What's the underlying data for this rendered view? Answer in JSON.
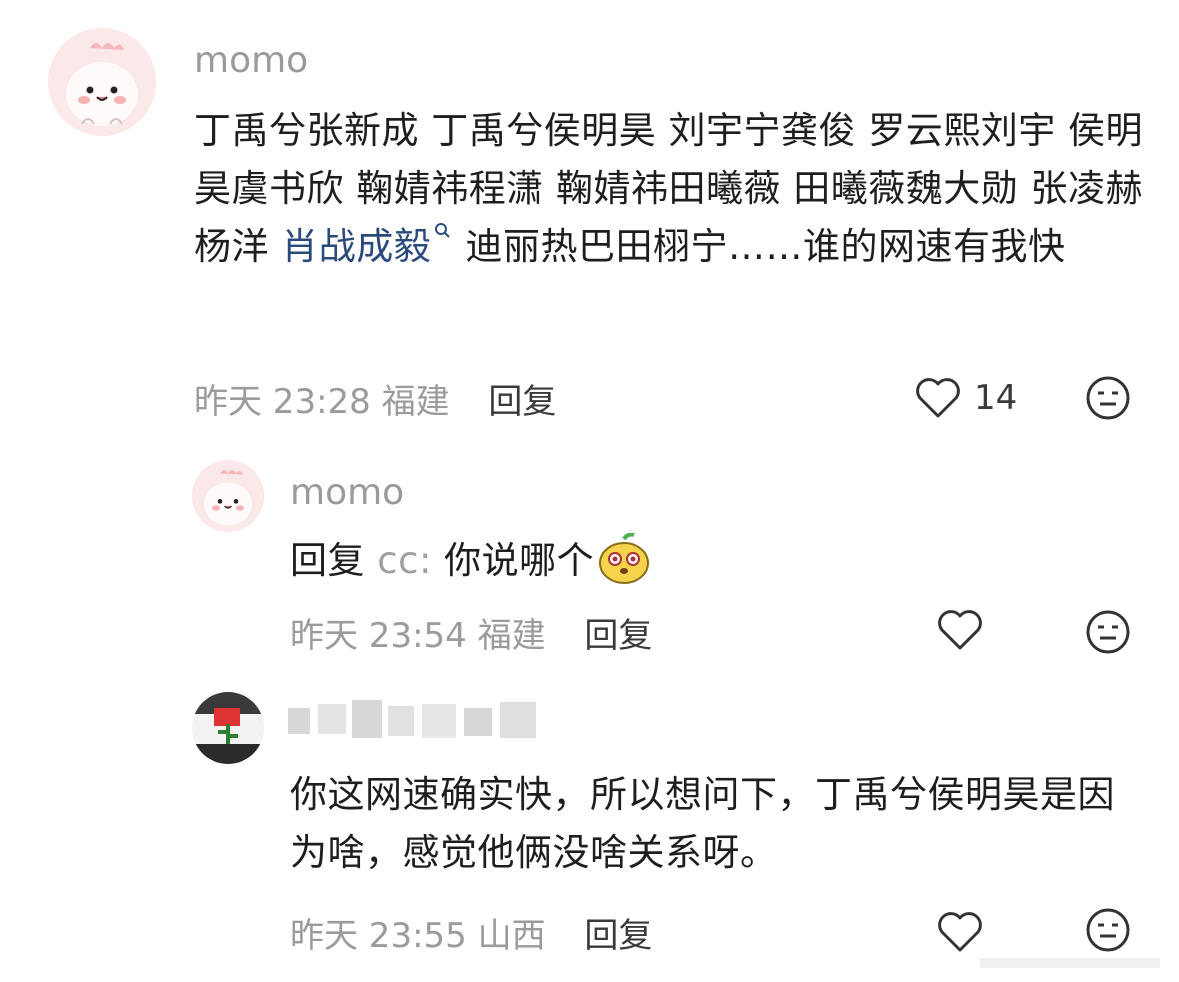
{
  "comments": [
    {
      "user": "momo",
      "text_before_link": "丁禹兮张新成 丁禹兮侯明昊 刘宇宁龚俊 罗云熙刘宇 侯明昊虞书欣 鞠婧祎程潇 鞠婧祎田曦薇 田曦薇魏大勋 张凌赫杨洋 ",
      "link_text": "肖战成毅",
      "text_after_link": " 迪丽热巴田栩宁……谁的网速有我快",
      "time": "昨天 23:28",
      "location": "福建",
      "reply_label": "回复",
      "likes": "14",
      "like_icon": "heart-icon",
      "react_icon": "neutral-face-icon"
    },
    {
      "user": "momo",
      "reply_prefix": "回复",
      "reply_target": "cc:",
      "text": " 你说哪个",
      "emoji_icon": "cute-face-emoji-icon",
      "time": "昨天 23:54",
      "location": "福建",
      "reply_label": "回复",
      "like_icon": "heart-icon",
      "react_icon": "neutral-face-icon"
    },
    {
      "user": "",
      "text": "你这网速确实快，所以想问下，丁禹兮侯明昊是因为啥，感觉他俩没啥关系呀。",
      "time": "昨天 23:55",
      "location": "山西",
      "reply_label": "回复",
      "like_icon": "heart-icon",
      "react_icon": "neutral-face-icon"
    }
  ]
}
